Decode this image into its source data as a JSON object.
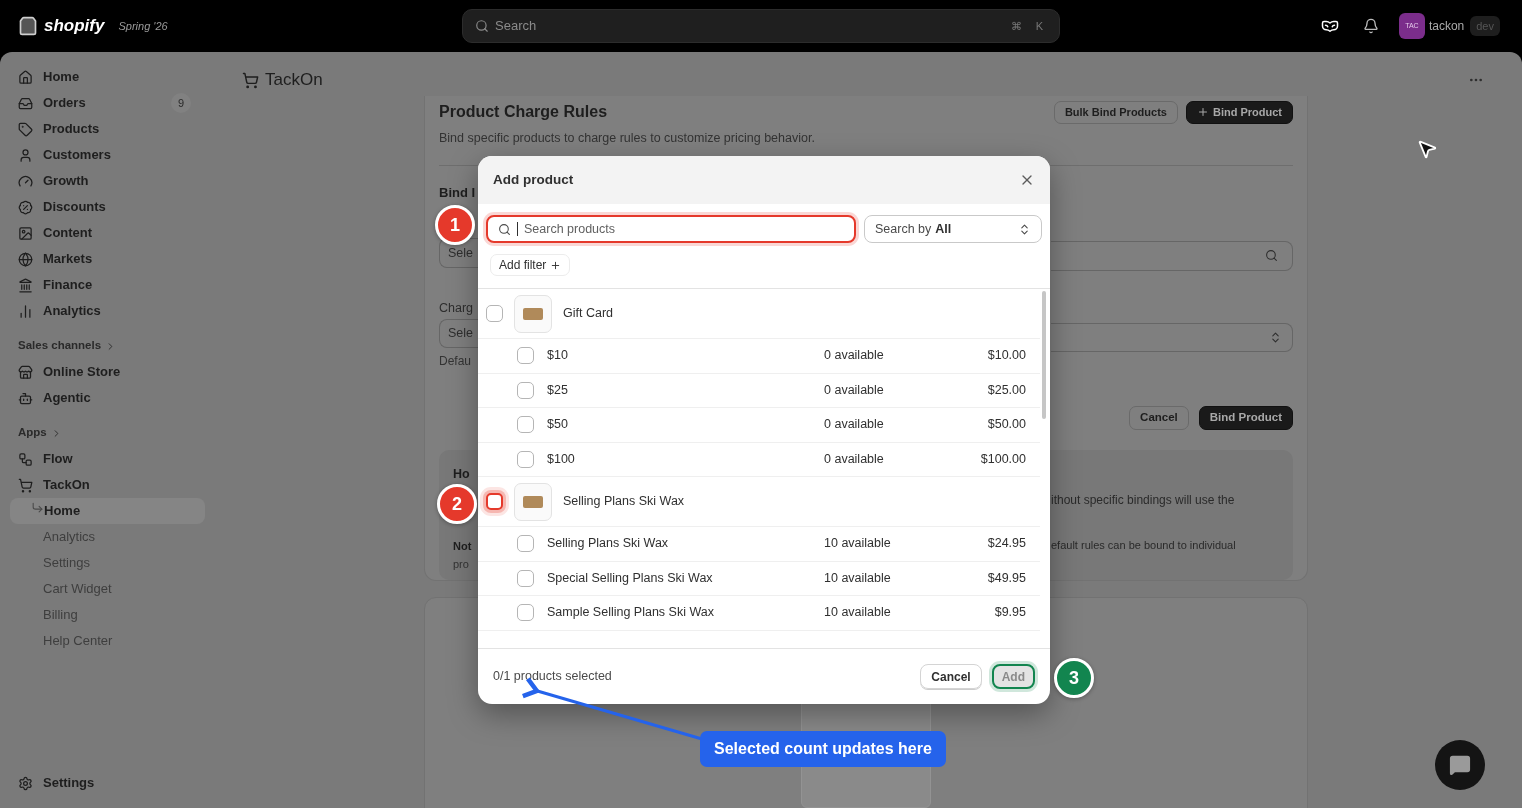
{
  "top_bar": {
    "brand": "shopify",
    "release": "Spring '26",
    "search": {
      "placeholder": "Search",
      "keys": [
        "⌘",
        "K"
      ]
    },
    "account": {
      "initials": "TAC",
      "name": "tackon",
      "badge": "dev"
    }
  },
  "sidebar": {
    "items": [
      {
        "label": "Home"
      },
      {
        "label": "Orders",
        "badge": "9"
      },
      {
        "label": "Products"
      },
      {
        "label": "Customers"
      },
      {
        "label": "Growth"
      },
      {
        "label": "Discounts"
      },
      {
        "label": "Content"
      },
      {
        "label": "Markets"
      },
      {
        "label": "Finance"
      },
      {
        "label": "Analytics"
      }
    ],
    "sections": [
      {
        "title": "Sales channels",
        "items": [
          {
            "label": "Online Store"
          },
          {
            "label": "Agentic"
          }
        ]
      },
      {
        "title": "Apps",
        "items": [
          {
            "label": "Flow"
          },
          {
            "label": "TackOn",
            "children": [
              {
                "label": "Home",
                "selected": true
              },
              {
                "label": "Analytics",
                "selected": false
              },
              {
                "label": "Settings",
                "selected": false
              },
              {
                "label": "Cart Widget",
                "selected": false
              },
              {
                "label": "Billing",
                "selected": false
              },
              {
                "label": "Help Center",
                "selected": false
              }
            ]
          }
        ]
      }
    ],
    "footer": {
      "label": "Settings"
    }
  },
  "app_header": {
    "title": "TackOn"
  },
  "page": {
    "title": "Product Charge Rules",
    "description": "Bind specific products to charge rules to customize pricing behavior.",
    "actions": [
      {
        "label": "Bulk Bind Products",
        "kind": "secondary"
      },
      {
        "label": "Bind Product",
        "kind": "primary"
      }
    ],
    "form": {
      "label": "Bind I",
      "product_field": "Sele",
      "charge_label": "Charg",
      "charge_select": "Sele",
      "hint": "Defau",
      "buttons": [
        {
          "label": "Cancel",
          "kind": "secondary"
        },
        {
          "label": "Bind Product",
          "kind": "primary"
        }
      ]
    },
    "info": {
      "title": "Ho",
      "text": "ithout specific bindings will use the",
      "note_label": "Not",
      "note_text": "pro",
      "note_more": "efault rules can be bound to individual"
    }
  },
  "modal": {
    "title": "Add product",
    "search": {
      "placeholder": "Search products"
    },
    "search_by": {
      "label": "Search by",
      "value": "All"
    },
    "filter_button": "Add filter",
    "products": [
      {
        "name": "Gift Card",
        "checked": false,
        "variants": [
          {
            "name": "$10",
            "available": "0 available",
            "price": "$10.00",
            "checked": false
          },
          {
            "name": "$25",
            "available": "0 available",
            "price": "$25.00",
            "checked": false
          },
          {
            "name": "$50",
            "available": "0 available",
            "price": "$50.00",
            "checked": false
          },
          {
            "name": "$100",
            "available": "0 available",
            "price": "$100.00",
            "checked": false
          }
        ]
      },
      {
        "name": "Selling Plans Ski Wax",
        "checked": false,
        "variants": [
          {
            "name": "Selling Plans Ski Wax",
            "available": "10 available",
            "price": "$24.95",
            "checked": false
          },
          {
            "name": "Special Selling Plans Ski Wax",
            "available": "10 available",
            "price": "$49.95",
            "checked": false
          },
          {
            "name": "Sample Selling Plans Ski Wax",
            "available": "10 available",
            "price": "$9.95",
            "checked": false
          }
        ]
      }
    ],
    "footer": {
      "count": "0/1 products selected",
      "cancel": "Cancel",
      "add": {
        "label": "Add",
        "disabled": true
      }
    }
  },
  "annotations": [
    {
      "number": "1",
      "color": "#e5392b"
    },
    {
      "number": "2",
      "color": "#e5392b"
    },
    {
      "number": "3",
      "color": "#12854f"
    }
  ],
  "callout": {
    "text": "Selected count updates here"
  }
}
